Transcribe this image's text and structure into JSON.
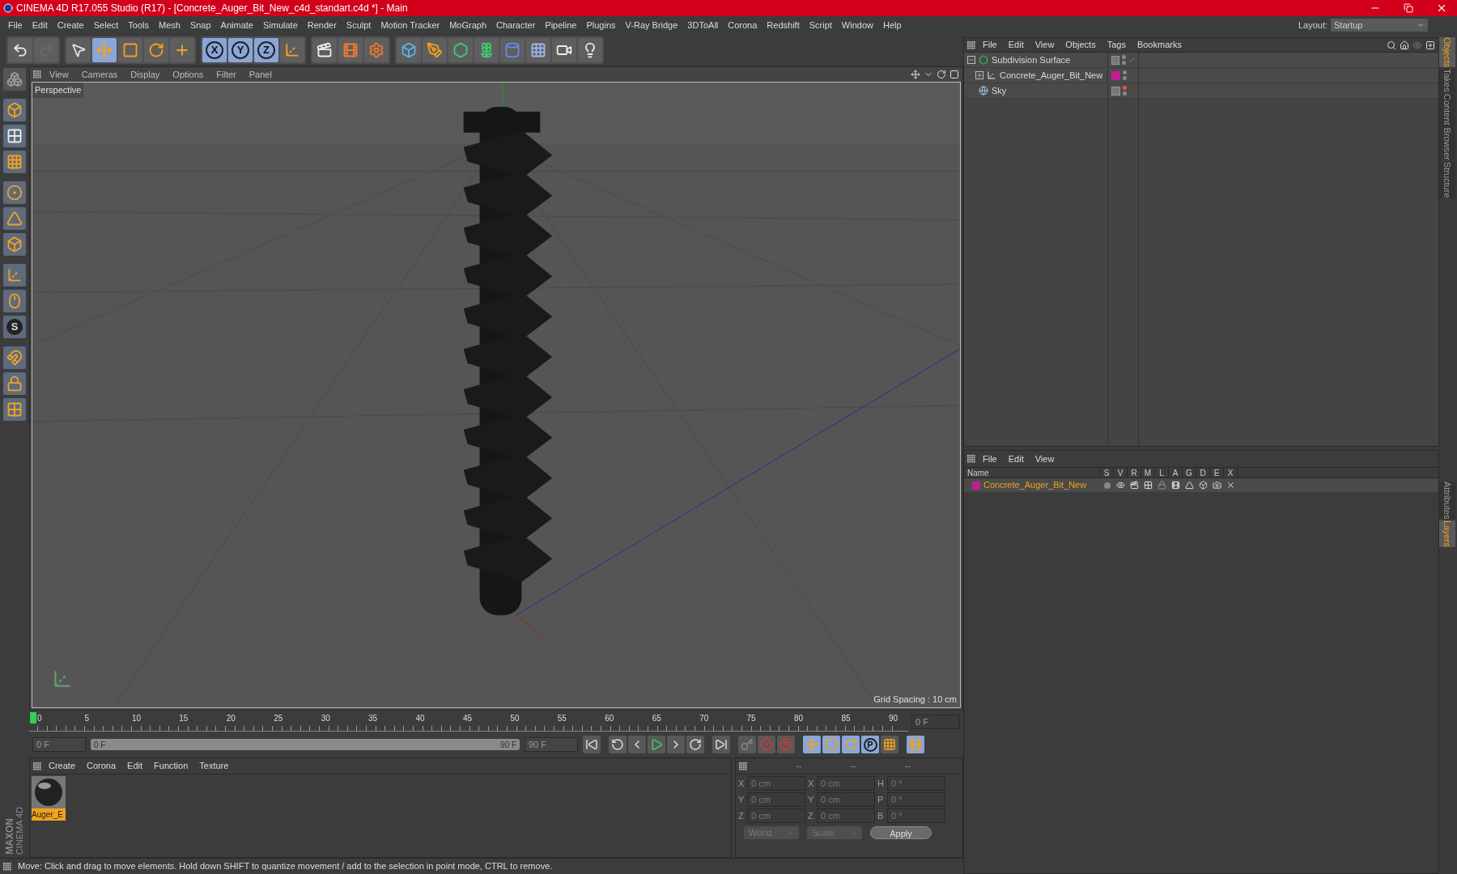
{
  "window": {
    "title": "CINEMA 4D R17.055 Studio (R17) - [Concrete_Auger_Bit_New_c4d_standart.c4d *] - Main"
  },
  "menu": [
    "File",
    "Edit",
    "Create",
    "Select",
    "Tools",
    "Mesh",
    "Snap",
    "Animate",
    "Simulate",
    "Render",
    "Sculpt",
    "Motion Tracker",
    "MoGraph",
    "Character",
    "Pipeline",
    "Plugins",
    "V-Ray Bridge",
    "3DToAll",
    "Corona",
    "Redshift",
    "Script",
    "Window",
    "Help"
  ],
  "layout": {
    "label": "Layout:",
    "value": "Startup"
  },
  "toolbar_groups": [
    [
      {
        "kind": "undo",
        "selected": false
      },
      {
        "kind": "redo",
        "selected": false
      }
    ],
    [
      {
        "kind": "select",
        "selected": false
      },
      {
        "kind": "move",
        "selected": true
      },
      {
        "kind": "scale",
        "selected": false
      },
      {
        "kind": "rotate",
        "selected": false
      },
      {
        "kind": "live",
        "selected": false
      }
    ],
    [
      {
        "kind": "axis",
        "label": "X",
        "selected": true
      },
      {
        "kind": "axis",
        "label": "Y",
        "selected": true
      },
      {
        "kind": "axis",
        "label": "Z",
        "selected": true
      },
      {
        "kind": "coords",
        "selected": false
      }
    ],
    [
      {
        "kind": "render_view",
        "selected": false
      },
      {
        "kind": "render_pv",
        "selected": false
      },
      {
        "kind": "render_settings",
        "selected": false
      }
    ],
    [
      {
        "kind": "cube",
        "selected": false
      },
      {
        "kind": "pen",
        "selected": false
      },
      {
        "kind": "subdivision",
        "selected": false
      },
      {
        "kind": "cloner",
        "selected": false
      },
      {
        "kind": "deformer",
        "selected": false
      },
      {
        "kind": "floor",
        "selected": false
      },
      {
        "kind": "camera",
        "selected": false
      },
      {
        "kind": "light",
        "selected": false
      }
    ]
  ],
  "left_tools": [
    {
      "kind": "modeling"
    },
    {
      "kind": "model"
    },
    {
      "kind": "texture"
    },
    {
      "kind": "workplane"
    },
    {
      "kind": "points"
    },
    {
      "kind": "edges"
    },
    {
      "kind": "polygons"
    },
    {
      "kind": "axis"
    },
    {
      "kind": "tweak"
    },
    {
      "kind": "solo",
      "label": "S"
    },
    {
      "kind": "snap"
    },
    {
      "kind": "lock"
    },
    {
      "kind": "planar"
    }
  ],
  "logo": {
    "brand": "MAXON",
    "product": "CINEMA 4D"
  },
  "viewport": {
    "menu": [
      "View",
      "Cameras",
      "Display",
      "Options",
      "Filter",
      "Panel"
    ],
    "camera": "Perspective",
    "grid_spacing": "Grid Spacing : 10 cm"
  },
  "timeline": {
    "ticks": [
      "0",
      "5",
      "10",
      "15",
      "20",
      "25",
      "30",
      "35",
      "40",
      "45",
      "50",
      "55",
      "60",
      "65",
      "70",
      "75",
      "80",
      "85",
      "90"
    ],
    "current": "0 F",
    "level": 0
  },
  "transport": {
    "start": "0 F",
    "level": 1,
    "range_start": "0 F",
    "range_end": "90 F",
    "end": "90 F",
    "buttons": [
      {
        "kind": "first"
      },
      {
        "kind": "gap"
      },
      {
        "kind": "prev_key"
      },
      {
        "kind": "prev"
      },
      {
        "kind": "play"
      },
      {
        "kind": "next"
      },
      {
        "kind": "next_key"
      },
      {
        "kind": "gap"
      },
      {
        "kind": "last"
      },
      {
        "kind": "gap"
      },
      {
        "kind": "record_off"
      },
      {
        "kind": "record"
      },
      {
        "kind": "help"
      },
      {
        "kind": "gap"
      },
      {
        "kind": "pos",
        "selected": true
      },
      {
        "kind": "scl",
        "selected": true
      },
      {
        "kind": "rot",
        "selected": true
      },
      {
        "kind": "param",
        "label": "P",
        "selected": true
      },
      {
        "kind": "pla",
        "selected": false
      },
      {
        "kind": "gap"
      },
      {
        "kind": "timeline",
        "selected": true
      }
    ]
  },
  "materials": {
    "menu": [
      "Create",
      "Corona",
      "Edit",
      "Function",
      "Texture"
    ],
    "items": [
      {
        "name": "Auger_E",
        "selected": true
      }
    ]
  },
  "coordinates": {
    "headers": [
      "--",
      "--",
      "--"
    ],
    "rows": [
      {
        "a": "X",
        "a_value": "0 cm",
        "b": "X",
        "b_value": "0 cm",
        "c": "H",
        "c_value": "0 °"
      },
      {
        "a": "Y",
        "a_value": "0 cm",
        "b": "Y",
        "b_value": "0 cm",
        "c": "P",
        "c_value": "0 °"
      },
      {
        "a": "Z",
        "a_value": "0 cm",
        "b": "Z",
        "b_value": "0 cm",
        "c": "B",
        "c_value": "0 °"
      }
    ],
    "space": "World",
    "mode": "Scale",
    "apply": "Apply"
  },
  "status_bar": "Move: Click and drag to move elements. Hold down SHIFT to quantize movement / add to the selection in point mode, CTRL to remove.",
  "objects": {
    "menu": [
      "File",
      "Edit",
      "View",
      "Objects",
      "Tags",
      "Bookmarks"
    ],
    "tree": [
      {
        "name": "Subdivision Surface",
        "kind": "subdivision",
        "expanded": true,
        "enabled": true,
        "editor_hidden": false,
        "children": [
          {
            "name": "Concrete_Auger_Bit_New",
            "kind": "null",
            "expanded": false,
            "color": "#c0208e",
            "editor_hidden": false
          }
        ]
      },
      {
        "name": "Sky",
        "kind": "sky",
        "editor_hidden": true
      }
    ]
  },
  "layers": {
    "menu": [
      "File",
      "Edit",
      "View"
    ],
    "columns": [
      "Name",
      "S",
      "V",
      "R",
      "M",
      "L",
      "A",
      "G",
      "D",
      "E",
      "X"
    ],
    "rows": [
      {
        "name": "Concrete_Auger_Bit_New",
        "color": "#c0208e"
      }
    ]
  },
  "side_tabs": [
    {
      "label": "Objects",
      "selected": true
    },
    {
      "label": "Takes",
      "selected": false
    },
    {
      "label": "Content Browser",
      "selected": false
    },
    {
      "label": "Structure",
      "selected": false
    }
  ],
  "side_tabs_lower": [
    {
      "label": "Attributes",
      "selected": false
    },
    {
      "label": "Layers",
      "selected": true
    }
  ]
}
